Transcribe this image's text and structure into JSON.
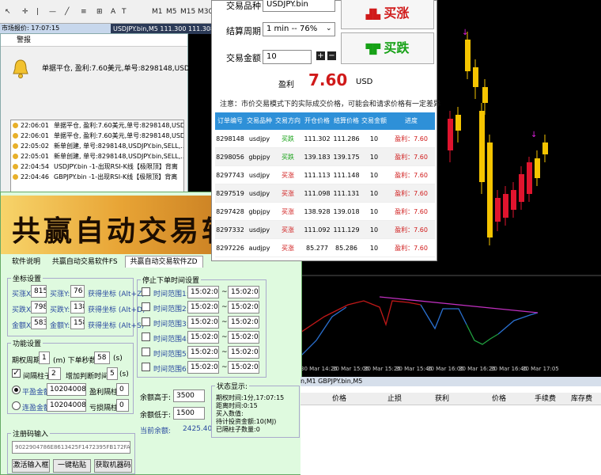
{
  "toolbar": {
    "items": [
      "M1",
      "M5",
      "M15",
      "M30"
    ]
  },
  "chart": {
    "title": "USDJPY.bin,M5  111.300 111.308 111.272 111",
    "time_labels": [
      "30 Mar 14:25",
      "30 Mar 15:05",
      "30 Mar 15:25",
      "30 Mar 15:45",
      "30 Mar 16:05",
      "30 Mar 16:25",
      "30 Mar 16:45",
      "30 Mar 17:05"
    ]
  },
  "market_watch": {
    "title": "市场报价: 17:07:15"
  },
  "alert": {
    "title": "警报",
    "message": "单据平仓, 盈利:7.60美元,单号:8298148,USDJPY.bin,卖,",
    "rows": [
      {
        "time": "22:06:01",
        "text": "单据平仓, 盈利:7.60美元,单号:8298148,USDJ..."
      },
      {
        "time": "22:06:01",
        "text": "单据平仓, 盈利:7.60美元,单号:8298148,USDJ..."
      },
      {
        "time": "22:05:02",
        "text": "新单创建, 单号:8298148,USDJPY.bin,SELL,..."
      },
      {
        "time": "22:05:01",
        "text": "新单创建, 单号:8298148,USDJPY.bin,SELL,..."
      },
      {
        "time": "22:04:54",
        "text": "USDJPY.bin -1-出现RSI-K线【极限顶】背离"
      },
      {
        "time": "22:04:46",
        "text": "GBPJPY.bin -1-出现RSI-K线【极限顶】背离"
      }
    ]
  },
  "zd": {
    "banner_title": "共赢自动交易软件",
    "tabs": [
      "软件说明",
      "共赢自动交易软件FS",
      "共赢自动交易软件ZD"
    ],
    "coord": {
      "legend": "坐标设置",
      "buy_x_label": "买涨X:",
      "buy_x": "815",
      "buy_y_label": "买涨Y:",
      "buy_y": "76",
      "buy_get": "获得坐标 (Alt+Z)",
      "sell_x_label": "买跌X:",
      "sell_x": "798",
      "sell_y_label": "买跌Y:",
      "sell_y": "138",
      "sell_get": "获得坐标 (Alt+D)",
      "amt_x_label": "金额X:",
      "amt_x": "583",
      "amt_y_label": "金额Y:",
      "amt_y": "158",
      "amt_get": "获得坐标 (Alt+S)"
    },
    "func": {
      "legend": "功能设置",
      "period_label": "期权周期",
      "period": "1",
      "period_unit": "(m) 下单秒数",
      "seconds": "58",
      "seconds_unit": "(s)",
      "interval_label": "间隔柱子",
      "interval": "2",
      "delay_label": "增加判断时间",
      "delay": "5",
      "delay_unit": "(s)",
      "flat_label": "平盈金额",
      "flat": "102040080",
      "profit_int_label": "盈利隔柱",
      "profit_int": "0",
      "cont_label": "连盈金额",
      "cont": "102040080",
      "loss_int_label": "亏损隔柱",
      "loss_int": "0"
    },
    "stop": {
      "legend": "停止下单时间设置",
      "rows": [
        {
          "label": "时间范围1:",
          "from": "15:02:03",
          "to": "15:02:03"
        },
        {
          "label": "时间范围2:",
          "from": "15:02:03",
          "to": "15:02:03"
        },
        {
          "label": "时间范围3:",
          "from": "15:02:03",
          "to": "15:02:03"
        },
        {
          "label": "时间范围4:",
          "from": "15:02:03",
          "to": "15:02:03"
        },
        {
          "label": "时间范围5:",
          "from": "15:02:03",
          "to": "15:02:03"
        },
        {
          "label": "时间范围6:",
          "from": "15:02:03",
          "to": "15:02:03"
        }
      ]
    },
    "balance": {
      "high_label": "余额高于:",
      "high": "3500",
      "low_label": "余额低于:",
      "low": "1500",
      "cur_label": "当前余额:",
      "cur": "2425.40"
    },
    "status": {
      "legend": "状态显示:",
      "lines": [
        "期权时间:1分,17:07:15",
        "距离时间:0:15",
        "买入数值:",
        "待计投资金额:10(MJ)",
        "已隔柱子数量:0"
      ]
    },
    "reg": {
      "legend": "注册码输入",
      "code": "9022904786E8613425F1472395FB172FAC94A",
      "btn_activate": "激活输入框",
      "btn_paste": "一键粘贴",
      "btn_get": "获取机器码"
    }
  },
  "trade": {
    "product_label": "交易品种",
    "product": "USDJPY.bin",
    "period_label": "结算周期",
    "period": "1 min -- 76%",
    "amount_label": "交易金额",
    "amount": "10",
    "buy_up": "买涨",
    "buy_down": "买跌",
    "profit_label": "盈利",
    "profit": "7.60",
    "currency": "USD",
    "notice": "注意：市价交易模式下的实际成交价格，可能会和请求价格有一定差异",
    "headers": [
      "订单编号",
      "交易品种",
      "交易方向",
      "开仓价格",
      "结算价格",
      "交易金额",
      "进度"
    ],
    "rows": [
      [
        "8298148",
        "usdjpy",
        "买跌",
        "111.302",
        "111.286",
        "10",
        "盈利：7.60"
      ],
      [
        "8298056",
        "gbpjpy",
        "买跌",
        "139.183",
        "139.175",
        "10",
        "盈利：7.60"
      ],
      [
        "8297743",
        "usdjpy",
        "买涨",
        "111.113",
        "111.148",
        "10",
        "盈利：7.60"
      ],
      [
        "8297519",
        "usdjpy",
        "买涨",
        "111.098",
        "111.131",
        "10",
        "盈利：7.60"
      ],
      [
        "8297428",
        "gbpjpy",
        "买涨",
        "138.928",
        "139.018",
        "10",
        "盈利：7.60"
      ],
      [
        "8297332",
        "usdjpy",
        "买涨",
        "111.092",
        "111.129",
        "10",
        "盈利：7.60"
      ],
      [
        "8297226",
        "audjpy",
        "买涨",
        "85.277",
        "85.286",
        "10",
        "盈利：7.60"
      ]
    ]
  },
  "bottom": {
    "tabs": "n,M1   GBPJPY.bin,M5",
    "headers": [
      "价格",
      "止损",
      "获利",
      "价格",
      "手续费",
      "库存费"
    ]
  },
  "colors": {
    "bull": "#e0142e",
    "bear": "#f5c400",
    "accent": "#2e90d8",
    "profit": "#d01a1a"
  }
}
